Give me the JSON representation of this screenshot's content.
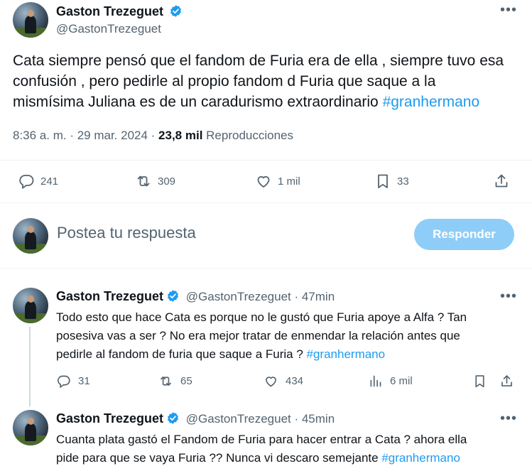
{
  "main_tweet": {
    "author_name": "Gaston Trezeguet",
    "author_handle": "@GastonTrezeguet",
    "text_line1": "Cata siempre pensó que el fandom de Furia era de ella , siempre tuvo esa",
    "text_line2": "confusión , pero pedirle al propio fandom d Furia que saque a la",
    "text_line3": "mismísima Juliana es de un caradurismo extraordinario ",
    "hashtag": "#granhermano",
    "time": "8:36 a. m. · 29 mar. 2024 · ",
    "views_count": "23,8 mil",
    "views_label": " Reproducciones",
    "replies": "241",
    "reposts": "309",
    "likes": "1 mil",
    "bookmarks": "33"
  },
  "compose": {
    "placeholder": "Postea tu respuesta",
    "button_label": "Responder"
  },
  "replies": [
    {
      "author_name": "Gaston Trezeguet",
      "author_handle": "@GastonTrezeguet",
      "time": " · 47min",
      "text_line1": "Todo esto que hace Cata es porque no le gustó que Furia apoye a Alfa ?  Tan",
      "text_line2": "posesiva vas a ser ? No era mejor tratar de enmendar la relación antes que",
      "text_line3": "pedirle al fandom de furia que saque a Furia ? ",
      "hashtag": "#granhermano",
      "replies": "31",
      "reposts": "65",
      "likes": "434",
      "views": "6 mil"
    },
    {
      "author_name": "Gaston Trezeguet",
      "author_handle": "@GastonTrezeguet",
      "time": " · 45min",
      "text_line1": "Cuanta plata gastó el Fandom de Furia para hacer entrar a Cata ? ahora ella",
      "text_line2": "pide para que se vaya Furia ?? Nunca vi descaro semejante ",
      "hashtag": "#granhermano"
    }
  ],
  "colors": {
    "accent": "#1d9bf0",
    "muted": "#536471",
    "button_disabled": "#8ecdf7"
  }
}
